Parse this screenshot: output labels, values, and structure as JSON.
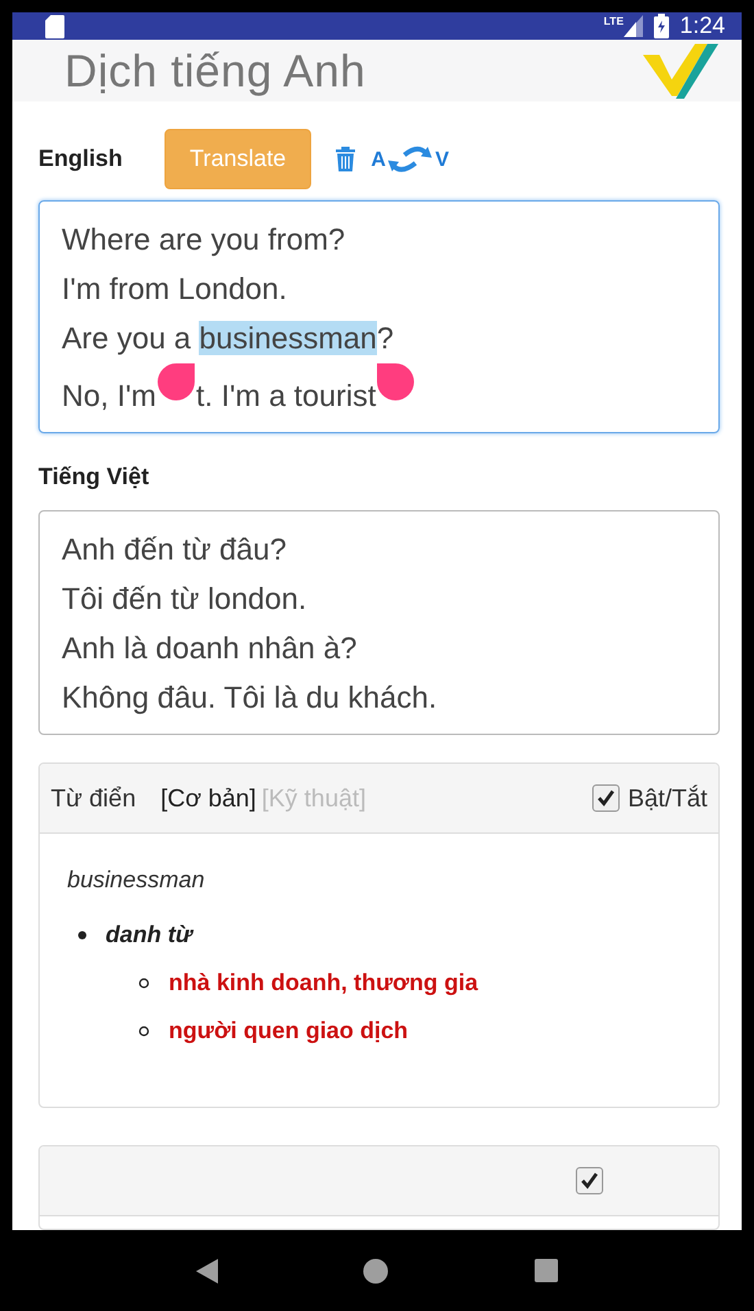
{
  "status_bar": {
    "time": "1:24",
    "network": "LTE"
  },
  "app_bar": {
    "title": "Dịch tiếng Anh"
  },
  "source": {
    "label": "English",
    "translate_button": "Translate",
    "swap_from": "A",
    "swap_to": "V",
    "lines": [
      [
        {
          "kind": "text",
          "text": "Where are you from?",
          "selected": false
        }
      ],
      [
        {
          "kind": "text",
          "text": "I'm from London.",
          "selected": false
        }
      ],
      [
        {
          "kind": "text",
          "text": "Are you a ",
          "selected": false
        },
        {
          "kind": "text",
          "text": "businessman",
          "selected": true
        },
        {
          "kind": "text",
          "text": "?",
          "selected": false
        }
      ],
      [
        {
          "kind": "text",
          "text": "No, I'm",
          "selected": false
        },
        {
          "kind": "handle"
        },
        {
          "kind": "text",
          "text": "t. I'm a tourist",
          "selected": false
        },
        {
          "kind": "handle"
        }
      ]
    ]
  },
  "target": {
    "label": "Tiếng Việt",
    "lines": [
      "Anh đến từ đâu?",
      "Tôi đến từ london.",
      "Anh là doanh nhân à?",
      "Không đâu. Tôi là du khách."
    ]
  },
  "dictionary": {
    "title": "Từ điển",
    "modes": [
      {
        "label": "[Cơ bản]",
        "selected": true
      },
      {
        "label": "[Kỹ thuật]",
        "selected": false
      }
    ],
    "toggle": {
      "label": "Bật/Tắt",
      "checked": true
    },
    "word": "businessman",
    "entries": [
      {
        "part_of_speech": "danh từ",
        "meanings": [
          "nhà kinh doanh, thương gia",
          "người quen giao dịch"
        ]
      }
    ]
  },
  "next_panel": {
    "checked": true
  }
}
